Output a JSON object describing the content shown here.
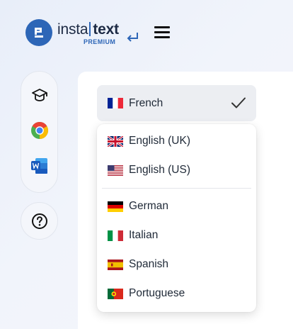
{
  "brand": {
    "name_part1": "insta",
    "name_part2": "text",
    "tier": "PREMIUM",
    "color": "#2d66b7"
  },
  "sidebar": {
    "items": [
      {
        "icon": "graduation-cap-icon"
      },
      {
        "icon": "chrome-icon"
      },
      {
        "icon": "word-icon"
      }
    ],
    "help_icon": "help-circle-icon"
  },
  "language_selector": {
    "selected": {
      "label": "French",
      "flag": "fr"
    },
    "options_group1": [
      {
        "label": "English (UK)",
        "flag": "gb"
      },
      {
        "label": "English (US)",
        "flag": "us"
      }
    ],
    "options_group2": [
      {
        "label": "German",
        "flag": "de"
      },
      {
        "label": "Italian",
        "flag": "it"
      },
      {
        "label": "Spanish",
        "flag": "es"
      },
      {
        "label": "Portuguese",
        "flag": "pt"
      }
    ]
  }
}
